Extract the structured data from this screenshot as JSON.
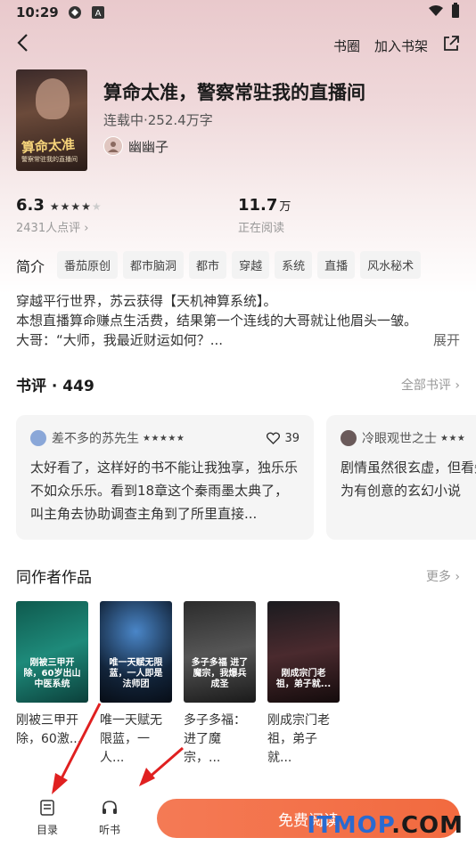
{
  "status_bar": {
    "time": "10:29"
  },
  "nav": {
    "circle_label": "书圈",
    "add_shelf_label": "加入书架"
  },
  "book": {
    "title": "算命太准，警察常驻我的直播间",
    "meta": "连载中·252.4万字",
    "author": "幽幽子",
    "cover_title": "算命太准",
    "cover_sub": "警察常驻我的直播间"
  },
  "stats": {
    "score": "6.3",
    "score_stars": "★★★★",
    "score_stars_dim": "★",
    "rating_count": "2431人点评 ›",
    "readers_value": "11.7",
    "readers_unit": "万",
    "readers_label": "正在阅读"
  },
  "intro": {
    "label": "简介",
    "tags": [
      "番茄原创",
      "都市脑洞",
      "都市",
      "穿越",
      "系统",
      "直播",
      "风水秘术"
    ],
    "line1": "穿越平行世界，苏云获得【天机神算系统】。",
    "line2": "本想直播算命赚点生活费，结果第一个连线的大哥就让他眉头一皱。",
    "line3": "大哥：“大师，我最近财运如何？...",
    "expand": "展开"
  },
  "reviews": {
    "heading": "书评 · 449",
    "more": "全部书评 ›",
    "items": [
      {
        "user": "差不多的苏先生",
        "stars": "★★★★★",
        "likes": "39",
        "text": "太好看了，这样好的书不能让我独享，独乐乐不如众乐乐。看到18章这个秦雨墨太典了，叫主角去协助调查主角到了所里直接..."
      },
      {
        "user": "冷眼观世之士",
        "stars": "★★★",
        "text": "剧情虽然很玄虚，但看失为有创意的玄幻小说"
      }
    ]
  },
  "works": {
    "heading": "同作者作品",
    "more": "更多 ›",
    "items": [
      {
        "title": "刚被三甲开除，60激...",
        "cover_text": "刚被三甲开除，60岁出山中医系统"
      },
      {
        "title": "唯一天赋无限蓝，一人...",
        "cover_text": "唯一天赋无限蓝，一人即是法师团"
      },
      {
        "title": "多子多福：进了魔宗，...",
        "cover_text": "多子多福 进了魔宗，我爆兵成圣"
      },
      {
        "title": "刚成宗门老祖，弟子就...",
        "cover_text": "刚成宗门老祖，弟子就..."
      }
    ]
  },
  "bottom": {
    "toc_label": "目录",
    "listen_label": "听书",
    "read_label": "免费阅读"
  },
  "watermark": {
    "a": "ITMOP",
    "b": ".COM"
  },
  "colors": {
    "accent": "#f26a3f",
    "arrow": "#e02020"
  }
}
